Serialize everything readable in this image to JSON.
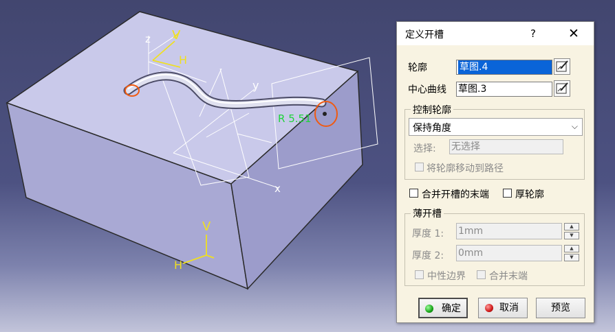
{
  "viewport": {
    "labels": {
      "sketch_z": "z",
      "sketch_v1": "V",
      "sketch_h1": "H",
      "sketch_y": "y",
      "sketch_x": "x",
      "radius": "R 5.51",
      "axis_v": "V",
      "axis_h": "H"
    },
    "colors": {
      "block_top": "#c9c9ea",
      "block_front": "#a9a9d4",
      "block_side": "#9c9ccb",
      "radius_label": "#1fd33a",
      "axis": "#f0e020",
      "profile": "#f05a10"
    }
  },
  "dialog": {
    "title": "定义开槽",
    "help": "?",
    "close": "✕",
    "profile_label": "轮廓",
    "profile_value": "草图.4",
    "center_curve_label": "中心曲线",
    "center_curve_value": "草图.3",
    "control_group_title": "控制轮廓",
    "control_mode_value": "保持角度",
    "select_label": "选择:",
    "select_value": "无选择",
    "move_profile_label": "将轮廓移动到路径",
    "merge_ends_label": "合并开槽的末端",
    "thick_profile_label": "厚轮廓",
    "thin_group_title": "薄开槽",
    "thickness1_label": "厚度 1:",
    "thickness1_value": "1mm",
    "thickness2_label": "厚度 2:",
    "thickness2_value": "0mm",
    "neutral_fiber_label": "中性边界",
    "merge_end_label": "合并末端",
    "ok_label": "确定",
    "cancel_label": "取消",
    "preview_label": "预览"
  }
}
